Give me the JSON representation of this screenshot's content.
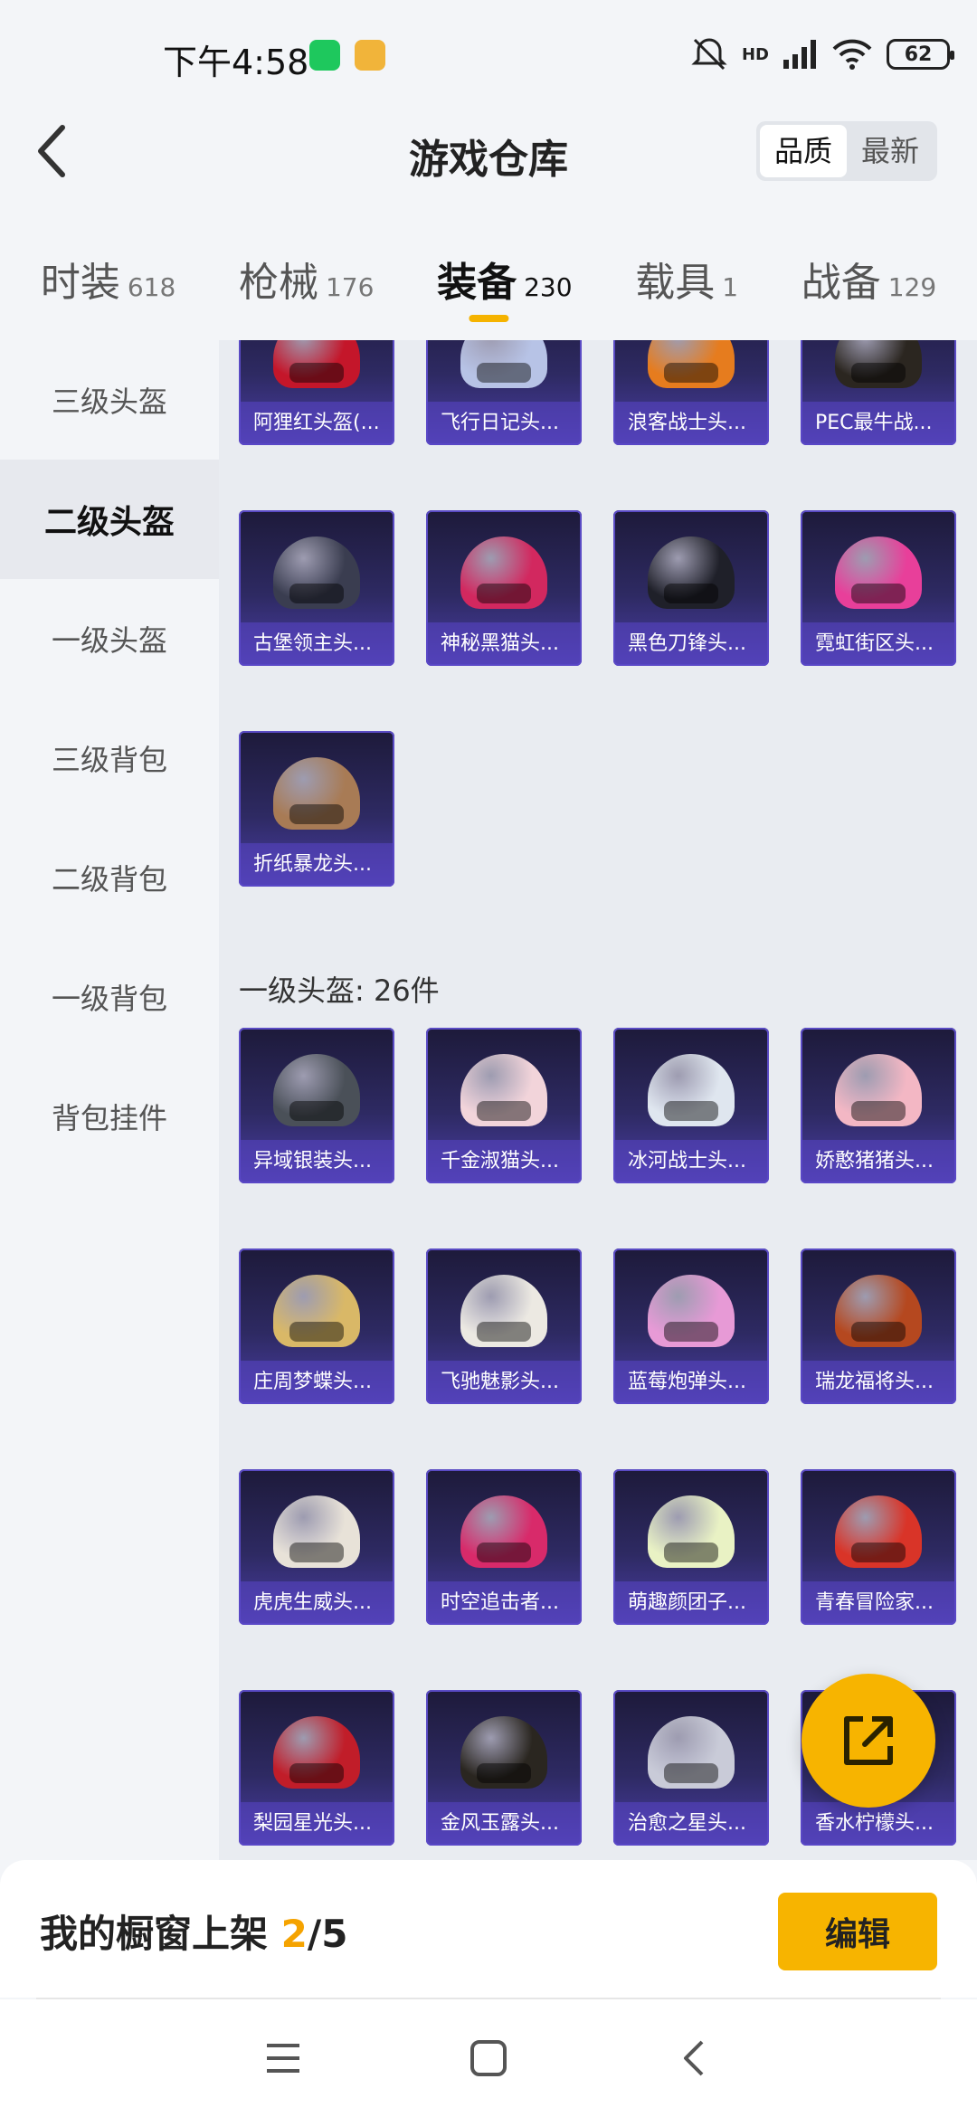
{
  "status_bar": {
    "time": "下午4:58",
    "battery": "62",
    "signal_label": "HD"
  },
  "header": {
    "title": "游戏仓库",
    "sort_options": [
      "品质",
      "最新"
    ],
    "active_sort": "品质"
  },
  "tabs": [
    {
      "label": "时装",
      "count": "618"
    },
    {
      "label": "枪械",
      "count": "176"
    },
    {
      "label": "装备",
      "count": "230"
    },
    {
      "label": "载具",
      "count": "1"
    },
    {
      "label": "战备",
      "count": "129"
    }
  ],
  "active_tab": "装备",
  "sidebar": {
    "items": [
      "三级头盔",
      "二级头盔",
      "一级头盔",
      "三级背包",
      "二级背包",
      "一级背包",
      "背包挂件"
    ],
    "active": "二级头盔"
  },
  "level2_items": [
    {
      "name": "阿狸红头盔(...",
      "color": "#c4162a"
    },
    {
      "name": "飞行日记头...",
      "color": "#b7c3e6"
    },
    {
      "name": "浪客战士头...",
      "color": "#e67c1e"
    },
    {
      "name": "PEC最牛战...",
      "color": "#2b2620"
    },
    {
      "name": "古堡领主头...",
      "color": "#3a3d50"
    },
    {
      "name": "神秘黑猫头...",
      "color": "#d2285f"
    },
    {
      "name": "黑色刀锋头...",
      "color": "#1f2029"
    },
    {
      "name": "霓虹街区头...",
      "color": "#e83f9a"
    },
    {
      "name": "折纸暴龙头...",
      "color": "#a87b55"
    }
  ],
  "level1_heading": "一级头盔: 26件",
  "level1_items": [
    {
      "name": "异域银装头...",
      "color": "#4a5058"
    },
    {
      "name": "千金淑猫头...",
      "color": "#f2d4da"
    },
    {
      "name": "冰河战士头...",
      "color": "#dfe6ef"
    },
    {
      "name": "娇憨猪猪头...",
      "color": "#f3b7c4"
    },
    {
      "name": "庄周梦蝶头...",
      "color": "#d9b867"
    },
    {
      "name": "飞驰魅影头...",
      "color": "#ece9e2"
    },
    {
      "name": "蓝莓炮弹头...",
      "color": "#e79ad6"
    },
    {
      "name": "瑞龙福将头...",
      "color": "#b5481f"
    },
    {
      "name": "虎虎生威头...",
      "color": "#e8e2d8"
    },
    {
      "name": "时空追击者...",
      "color": "#d82a6a"
    },
    {
      "name": "萌趣颜团子...",
      "color": "#e9f2c4"
    },
    {
      "name": "青春冒险家...",
      "color": "#d93428"
    },
    {
      "name": "梨园星光头...",
      "color": "#c11d29"
    },
    {
      "name": "金风玉露头...",
      "color": "#2a2620"
    },
    {
      "name": "治愈之星头...",
      "color": "#c9cbd8"
    },
    {
      "name": "香水柠檬头...",
      "color": "#e8d24a"
    }
  ],
  "showcase": {
    "label": "我的橱窗上架 ",
    "current": "2",
    "separator": "/",
    "total": "5",
    "edit_label": "编辑"
  },
  "colors": {
    "accent": "#f7b400",
    "card_top": "#1d1a3a",
    "card_bottom": "#4b3ea8"
  }
}
